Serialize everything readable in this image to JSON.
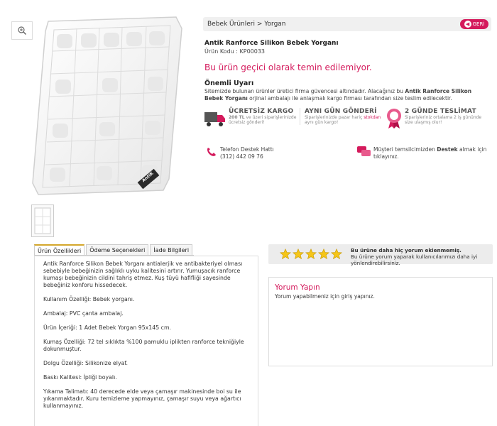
{
  "breadcrumb": "Bebek Ürünleri > Yorgan",
  "back_label": "GERİ",
  "product": {
    "title": "Antik Ranforce Silikon Bebek Yorganı",
    "code": "Ürün Kodu : KP00033",
    "unavailable": "Bu ürün geçici olarak temin edilemiyor."
  },
  "warning": {
    "title": "Önemli Uyarı",
    "text_pre": "Sitemizde bulunan ürünler üretici firma güvencesi altındadır. Alacağınız bu ",
    "text_bold": "Antik Ranforce Silikon Bebek Yorganı",
    "text_post": " orjinal ambalajı ile anlaşmalı kargo firması tarafından size teslim edilecektir."
  },
  "features": [
    {
      "title": "ÜCRETSİZ KARGO",
      "sub_strong": "200 TL",
      "sub": " ve üzeri siparişlerinizde ücretsiz gönderi!"
    },
    {
      "title": "AYNI GÜN GÖNDERİ",
      "sub": "Siparişlerinizde pazar hariç ",
      "sub_strong": "stokdan",
      "sub_end": " aynı gün kargo!"
    },
    {
      "title": "2 GÜNDE TESLİMAT",
      "sub": "Siparişleriniz ortalama 2 iş gününde size ulaşmış olur!"
    }
  ],
  "support": {
    "phone_label": "Telefon Destek Hattı",
    "phone_number": "(312) 442 09 76",
    "chat_pre": "Müşteri temsilcimizden ",
    "chat_bold": "Destek",
    "chat_post": " almak için tıklayınız."
  },
  "tabs": [
    "Ürün Özellikleri",
    "Ödeme Seçenekleri",
    "İade Bilgileri"
  ],
  "description": [
    "Antik Ranforce Silikon Bebek Yorganı antialerjik ve antibakteriyel olması sebebiyle bebeğinizin sağlıklı uyku kalitesini artırır. Yumuşacık ranforce kumaşı bebeğinizin cildini tahriş etmez. Kuş tüyü hafifliği sayesinde bebeğiniz konforu hissedecek.",
    "Kullanım Özelliği: Bebek yorganı.",
    "Ambalaj: PVC çanta ambalaj.",
    "Ürün İçeriği: 1 Adet Bebek Yorgan 95x145 cm.",
    "Kumaş Özelliği: 72 tel sıklıkta %100 pamuklu iplikten ranforce tekniğiyle dokunmuştur.",
    "Dolgu Özelliği: Silikonize elyaf.",
    "Baskı Kalitesi: İpliği boyalı.",
    "Yıkama Talimatı: 40 derecede elde veya çamaşır makinesinde boi su ile yıkanmaktadır. Kuru temizleme yapmayınız, çamaşır suyu veya ağartıcı kullanmayınız."
  ],
  "rating": {
    "stars": 5,
    "line1": "Bu ürüne daha hiç yorum ekienmemiş.",
    "line2": "Bu ürüne yorum yaparak kullanıcılarımızı daha iyi yönlendirebilirsiniz."
  },
  "review": {
    "title": "Yorum Yapın",
    "text": "Yorum yapabilmeniz için giriş yapınız."
  },
  "brand_tag": "AntiK",
  "colors": {
    "accent": "#d41a5c",
    "star": "#f5c518"
  }
}
